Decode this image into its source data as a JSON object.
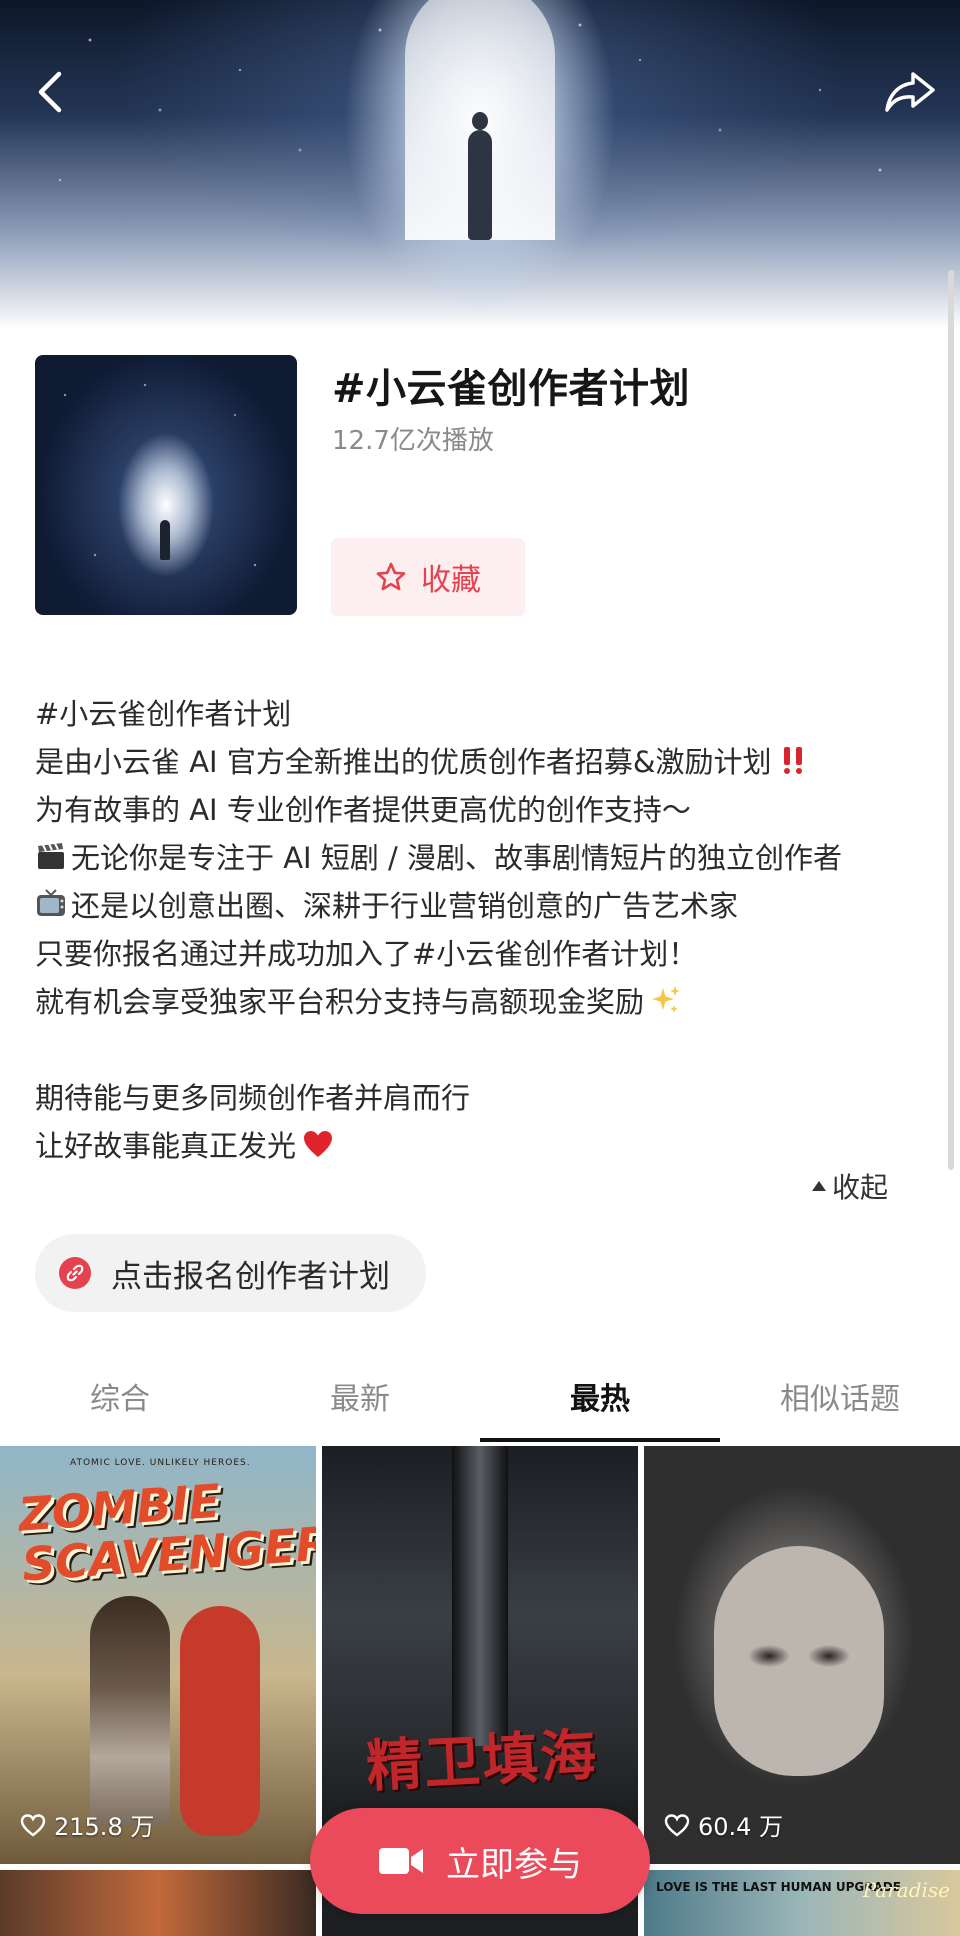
{
  "header": {
    "back_icon": "chevron-left-icon",
    "share_icon": "share-arrow-icon"
  },
  "topic": {
    "title": "#小云雀创作者计划",
    "stats": "12.7亿次播放",
    "favorite_label": "收藏"
  },
  "description": {
    "lines": [
      "#小云雀创作者计划",
      "是由小云雀 AI 官方全新推出的优质创作者招募&激励计划",
      "为有故事的 AI 专业创作者提供更高优的创作支持～",
      "无论你是专注于 AI 短剧 / 漫剧、故事剧情短片的独立创作者",
      "还是以创意出圈、深耕于行业营销创意的广告艺术家",
      "只要你报名通过并成功加入了#小云雀创作者计划！",
      "就有机会享受独家平台积分支持与高额现金奖励",
      "",
      "期待能与更多同频创作者并肩而行",
      "让好故事能真正发光"
    ],
    "collapse_label": "收起"
  },
  "signup_link": {
    "label": "点击报名创作者计划"
  },
  "tabs": [
    {
      "label": "综合",
      "active": false
    },
    {
      "label": "最新",
      "active": false
    },
    {
      "label": "最热",
      "active": true
    },
    {
      "label": "相似话题",
      "active": false
    }
  ],
  "videos": [
    {
      "poster_title": "ZOMBIE SCAVENGER",
      "poster_sub": "ATOMIC LOVE. UNLIKELY HEROES.",
      "likes": "215.8 万"
    },
    {
      "poster_title": "精卫填海",
      "likes": ""
    },
    {
      "poster_title": "",
      "likes": "60.4 万"
    },
    {
      "poster_title": "",
      "likes": ""
    },
    {
      "poster_title": "",
      "likes": ""
    },
    {
      "poster_title": "LOVE IS THE LAST HUMAN UPGRADE",
      "badge": "Paradise",
      "likes": ""
    }
  ],
  "cta": {
    "label": "立即参与",
    "icon": "video-camera-icon"
  },
  "colors": {
    "accent": "#ea4a5a",
    "favorite_text": "#e5424f",
    "favorite_bg": "#fdeff0"
  }
}
